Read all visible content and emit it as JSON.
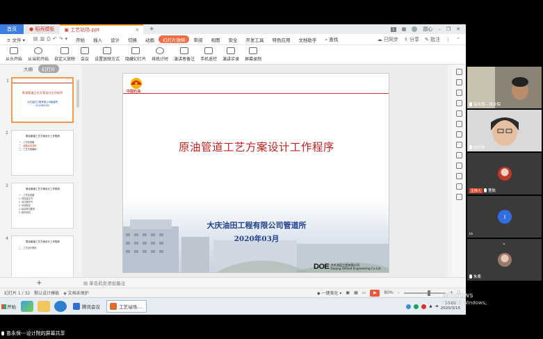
{
  "window": {
    "tabs": [
      {
        "label": "首页"
      },
      {
        "label": "稻壳模板"
      },
      {
        "label": "工艺站场.ppt"
      }
    ],
    "tab_add": "+",
    "page_count_badge": "1",
    "user_label": "甜心"
  },
  "menu": {
    "file": "文件",
    "items": [
      "开始",
      "插入",
      "设计",
      "切换",
      "动画",
      "幻灯片放映",
      "审阅",
      "视图",
      "安全",
      "开发工具",
      "特色应用",
      "文档助手"
    ],
    "active": "幻灯片放映",
    "search": "查找",
    "sync": "已同步",
    "share": "分享",
    "comment": "批注"
  },
  "ribbon": {
    "buttons": [
      "从头开始",
      "从当前开始",
      "自定义放映",
      "会议",
      "设置放映方式",
      "隐藏幻灯片",
      "排练计时",
      "演讲者备注",
      "手机遥控",
      "演讲实录",
      "屏幕录制"
    ]
  },
  "panel": {
    "outline": "大纲",
    "slides": "幻灯片"
  },
  "thumbnails": [
    {
      "num": "1",
      "title": "原油管道工艺方案设计工作程序",
      "sub1": "大庆油田工程有限公司管道所",
      "sub2": "2020年03月"
    },
    {
      "num": "2",
      "head": "原油管道工艺方案设计工作程序",
      "lines": [
        "一、工作前准备",
        "二、线路走向选择",
        "三、工艺方案编制"
      ]
    },
    {
      "num": "3",
      "head": "原油管道工艺方案设计工作程序",
      "lines": [
        "一、工作前准备",
        "1. 项目建议书",
        "2. 设计委托书",
        "3. 可研报告",
        "4. 建设单位要求",
        "5. 相关资料"
      ]
    },
    {
      "num": "4",
      "head": "原油管道工艺方案设计工作程序",
      "lines": [
        "二、工艺设计程序"
      ]
    }
  ],
  "slide": {
    "logo_text": "中国石油",
    "title": "原油管道工艺方案设计工作程序",
    "company": "大庆油田工程有限公司管道所",
    "date": "2020年03月",
    "doe_mark": "DOE",
    "doe_cn": "大庆油田工程有限公司",
    "doe_en": "Daqing Oilfield Engineering Co Ltd"
  },
  "notes": {
    "add": "+",
    "hint": "单击此处添加备注"
  },
  "status": {
    "slide_pos": "幻灯片 1 / 32",
    "template": "默认设计模板",
    "protect": "文档未保护",
    "beautify": "一键美化",
    "zoom": "80%"
  },
  "taskbar": {
    "start": "开始",
    "apps": [
      {
        "label": "腾讯会议"
      },
      {
        "label": "工艺站场...."
      }
    ],
    "time": "10:02",
    "date": "2020/3/15"
  },
  "watermark": {
    "line1": "Windows",
    "line2": "门以激活 Windows。"
  },
  "participants": [
    {
      "name": "苗永保---设计院"
    },
    {
      "name": "成庆林"
    },
    {
      "name": "曹航",
      "badge": "主持人"
    },
    {
      "name": "io"
    },
    {
      "name": "朱柔"
    }
  ],
  "share_label": "苗永保---设计院的屏幕共享"
}
